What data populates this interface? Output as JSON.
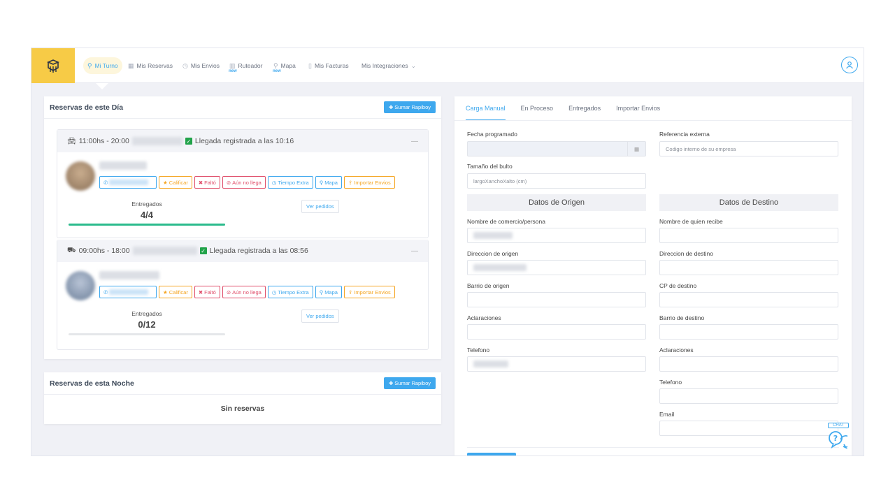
{
  "nav": {
    "items": [
      {
        "label": "Mi Turno",
        "icon": "bike-icon"
      },
      {
        "label": "Mis Reservas",
        "icon": "calendar-icon"
      },
      {
        "label": "Mis Envios",
        "icon": "clock-icon"
      },
      {
        "label": "Ruteador",
        "icon": "map-icon",
        "tag": "new"
      },
      {
        "label": "Mapa",
        "icon": "pin-icon",
        "tag": "new"
      },
      {
        "label": "Mis Facturas",
        "icon": "document-icon"
      },
      {
        "label": "Mis Integraciones",
        "icon": "chevron-down-icon"
      }
    ]
  },
  "left": {
    "dia": {
      "title": "Reservas de este Día",
      "add_label": "Sumar Rapiboy",
      "reservas": [
        {
          "time": "11:00hs - 20:00",
          "vehicle_icon": "car-icon",
          "arrival": "Llegada registrada a las 10:16",
          "entregados_label": "Entregados",
          "entregados": "4/4",
          "progress": 1.0,
          "ver_label": "Ver pedidos"
        },
        {
          "time": "09:00hs - 18:00",
          "vehicle_icon": "truck-icon",
          "arrival": "Llegada registrada a las 08:56",
          "entregados_label": "Entregados",
          "entregados": "0/12",
          "progress": 0.0,
          "ver_label": "Ver pedidos"
        }
      ],
      "actions": [
        "Calificar",
        "Faltó",
        "Aún no llega",
        "Tiempo Extra",
        "Mapa",
        "Importar Envios"
      ]
    },
    "noche": {
      "title": "Reservas de esta Noche",
      "add_label": "Sumar Rapiboy",
      "empty": "Sin reservas"
    }
  },
  "right": {
    "tabs": [
      "Carga Manual",
      "En Proceso",
      "Entregados",
      "Importar Envios"
    ],
    "fecha_label": "Fecha programado",
    "ref_label": "Referencia externa",
    "ref_placeholder": "Codigo interno de su empresa",
    "tamano_label": "Tamaño del bulto",
    "tamano_placeholder": "largoXanchoXalto (cm)",
    "origen_title": "Datos de Origen",
    "destino_title": "Datos de Destino",
    "origen_fields": [
      "Nombre de comercio/persona",
      "Direccion de origen",
      "Barrio de origen",
      "Aclaraciones",
      "Telefono"
    ],
    "destino_fields": [
      "Nombre de quien recibe",
      "Direccion de destino",
      "CP de destino",
      "Barrio de destino",
      "Aclaraciones",
      "Telefono",
      "Email"
    ],
    "chat_label": "CHAT"
  }
}
